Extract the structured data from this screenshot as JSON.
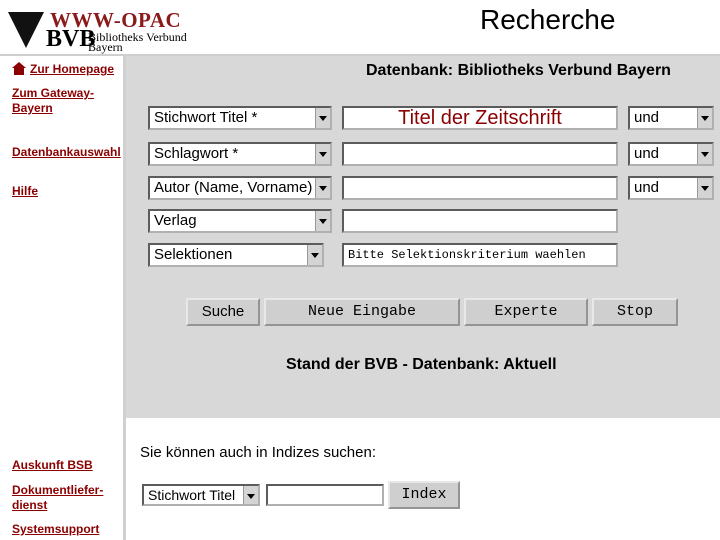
{
  "header": {
    "logo_opac": "WWW-OPAC",
    "logo_bvb": "BVB",
    "logo_org_line1": "Bibliotheks Verbund",
    "logo_org_line2": "Bayern",
    "title": "Recherche"
  },
  "sidebar": {
    "homepage": "Zur Homepage",
    "gateway_line1": "Zum Gateway-",
    "gateway_line2": "Bayern",
    "db_select": "Datenbankauswahl",
    "help": "Hilfe",
    "auskunft": "Auskunft BSB",
    "doc_line1": "Dokumentliefer-",
    "doc_line2": "dienst",
    "support": "Systemsupport"
  },
  "main": {
    "database_label": "Datenbank: Bibliotheks Verbund Bayern",
    "rows": [
      {
        "field": "Stichwort Titel *",
        "value": "Titel der Zeitschrift",
        "operator": "und"
      },
      {
        "field": "Schlagwort *",
        "value": "",
        "operator": "und"
      },
      {
        "field": "Autor (Name, Vorname)",
        "value": "",
        "operator": "und"
      },
      {
        "field": "Verlag",
        "value": ""
      },
      {
        "field": "Selektionen",
        "value": "Bitte Selektionskriterium waehlen"
      }
    ],
    "buttons": {
      "search": "Suche",
      "new_entry": "Neue Eingabe",
      "expert": "Experte",
      "stop": "Stop"
    },
    "status": "Stand der BVB - Datenbank: Aktuell",
    "index_hint": "Sie können auch in Indizes suchen:",
    "index_field": "Stichwort Titel",
    "index_value": "",
    "index_button": "Index"
  }
}
